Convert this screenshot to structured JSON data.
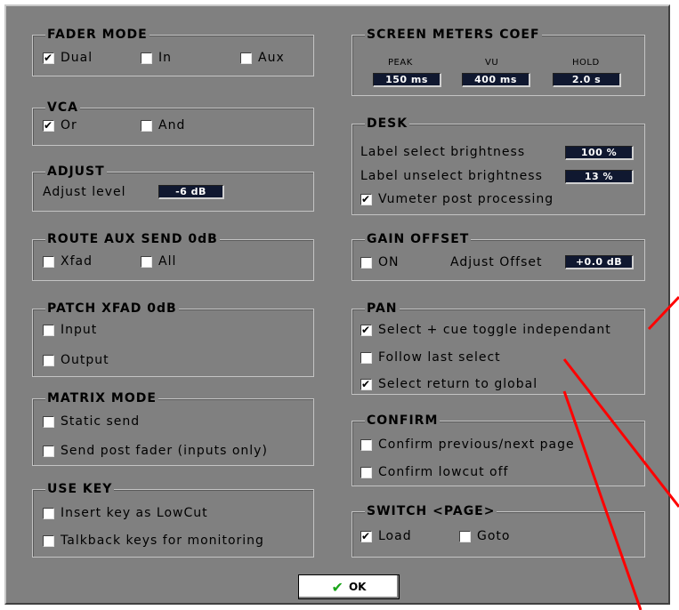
{
  "fader_mode": {
    "title": "FADER MODE",
    "dual": "Dual",
    "in": "In",
    "aux": "Aux",
    "dual_checked": true,
    "in_checked": false,
    "aux_checked": false
  },
  "vca": {
    "title": "VCA",
    "or": "Or",
    "and": "And",
    "or_checked": true,
    "and_checked": false
  },
  "adjust": {
    "title": "ADJUST",
    "label": "Adjust level",
    "value": "-6 dB"
  },
  "route_aux": {
    "title": "ROUTE AUX SEND 0dB",
    "xfad": "Xfad",
    "all": "All"
  },
  "patch_xfad": {
    "title": "PATCH XFAD 0dB",
    "input": "Input",
    "output": "Output"
  },
  "matrix_mode": {
    "title": "MATRIX MODE",
    "static_send": "Static send",
    "send_post": "Send post fader (inputs only)"
  },
  "use_key": {
    "title": "USE KEY",
    "insert_key": "Insert key as LowCut",
    "talkback": "Talkback keys for monitoring"
  },
  "screen_meters": {
    "title": "SCREEN METERS COEF",
    "peak_label": "PEAK",
    "vu_label": "VU",
    "hold_label": "HOLD",
    "peak": "150 ms",
    "vu": "400 ms",
    "hold": "2.0 s"
  },
  "desk": {
    "title": "DESK",
    "select_label": "Label select brightness",
    "select_value": "100 %",
    "unselect_label": "Label unselect brightness",
    "unselect_value": "13 %",
    "vumeter": "Vumeter post processing",
    "vumeter_checked": true
  },
  "gain_offset": {
    "title": "GAIN OFFSET",
    "on": "ON",
    "adjust_label": "Adjust Offset",
    "adjust_value": "+0.0 dB"
  },
  "pan": {
    "title": "PAN",
    "select_cue": "Select + cue toggle independant",
    "follow": "Follow last select",
    "return_global": "Select return to global",
    "select_cue_checked": true,
    "follow_checked": false,
    "return_global_checked": true
  },
  "confirm": {
    "title": "CONFIRM",
    "prev_next": "Confirm previous/next page",
    "lowcut": "Confirm lowcut off"
  },
  "switch_page": {
    "title": "SWITCH <PAGE>",
    "load": "Load",
    "goto": "Goto",
    "load_checked": true,
    "goto_checked": false
  },
  "ok_button": {
    "label": "OK"
  },
  "colors": {
    "panel": "#808080",
    "value_box": "#101830",
    "annotation_line": "#ff0000",
    "ok_check": "#1aa51a"
  },
  "check_glyph": "✔"
}
